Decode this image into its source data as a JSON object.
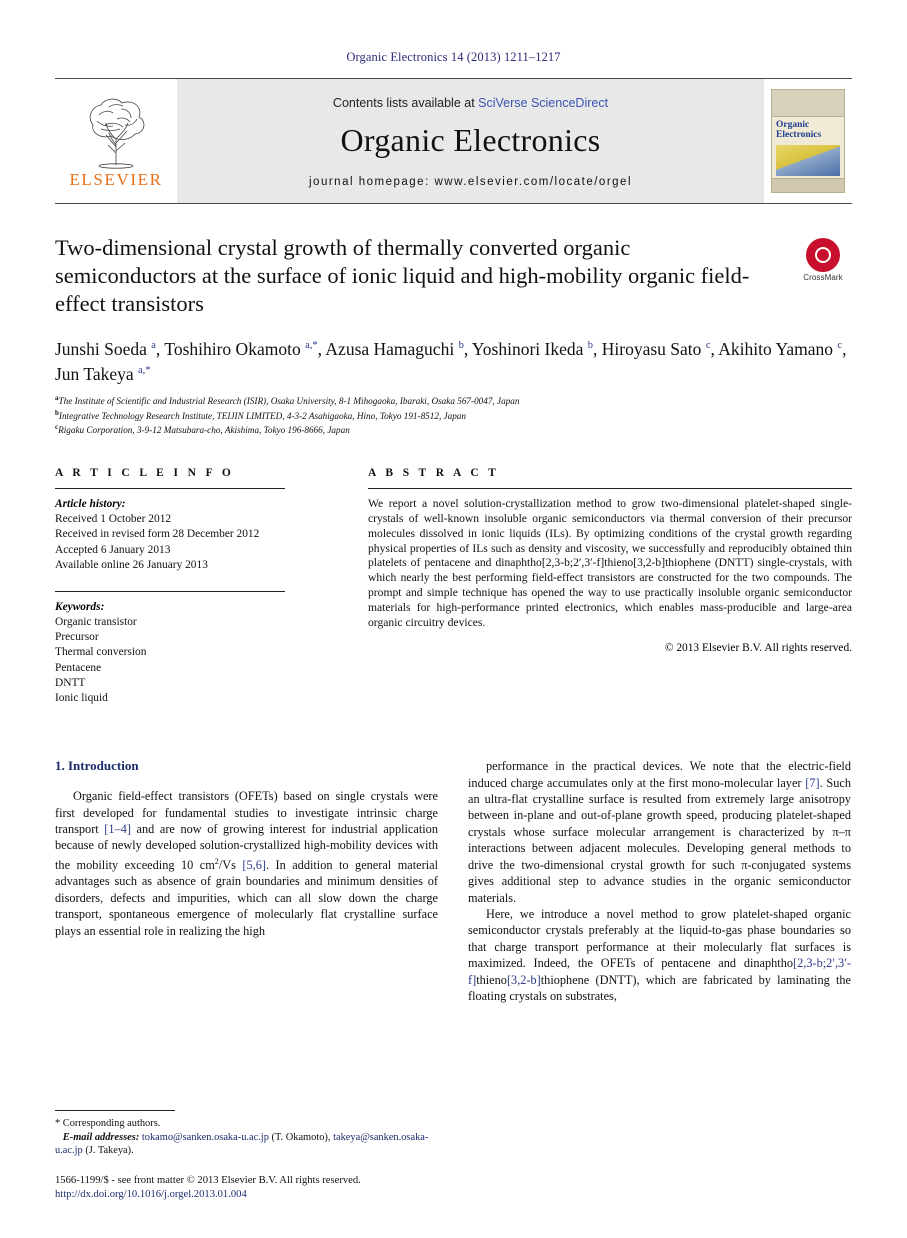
{
  "running_head": "Organic Electronics 14 (2013) 1211–1217",
  "banner": {
    "publisher_name": "ELSEVIER",
    "contents_prefix": "Contents lists available at ",
    "contents_link": "SciVerse ScienceDirect",
    "journal_name": "Organic Electronics",
    "homepage": "journal homepage: www.elsevier.com/locate/orgel",
    "cover_title_line1": "Organic",
    "cover_title_line2": "Electronics"
  },
  "article": {
    "title": "Two-dimensional crystal growth of thermally converted organic semiconductors at the surface of ionic liquid and high-mobility organic field-effect transistors",
    "crossmark_label": "CrossMark",
    "authors_html": "Junshi Soeda <sup>a</sup>, Toshihiro Okamoto <sup>a,</sup><sup>*</sup>, Azusa Hamaguchi <sup>b</sup>, Yoshinori Ikeda <sup>b</sup>, Hiroyasu Sato <sup>c</sup>, Akihito Yamano <sup>c</sup>, Jun Takeya <sup>a,</sup><sup>*</sup>",
    "affiliations": [
      "The Institute of Scientific and Industrial Research (ISIR), Osaka University, 8-1 Mihogaoka, Ibaraki, Osaka 567-0047, Japan",
      "Integrative Technology Research Institute, TEIJIN LIMITED, 4-3-2 Asahigaoka, Hino, Tokyo 191-8512, Japan",
      "Rigaku Corporation, 3-9-12 Matsubara-cho, Akishima, Tokyo 196-8666, Japan"
    ],
    "affiliation_marks": [
      "a",
      "b",
      "c"
    ]
  },
  "article_info": {
    "heading": "A R T I C L E    I N F O",
    "history_title": "Article history:",
    "history": [
      "Received 1 October 2012",
      "Received in revised form 28 December 2012",
      "Accepted 6 January 2013",
      "Available online 26 January 2013"
    ],
    "keywords_title": "Keywords:",
    "keywords": [
      "Organic transistor",
      "Precursor",
      "Thermal conversion",
      "Pentacene",
      "DNTT",
      "Ionic liquid"
    ]
  },
  "abstract": {
    "heading": "A B S T R A C T",
    "text": "We report a novel solution-crystallization method to grow two-dimensional platelet-shaped single-crystals of well-known insoluble organic semiconductors via thermal conversion of their precursor molecules dissolved in ionic liquids (ILs). By optimizing conditions of the crystal growth regarding physical properties of ILs such as density and viscosity, we successfully and reproducibly obtained thin platelets of pentacene and dinaphtho[2,3-b;2′,3′-f]thieno[3,2-b]thiophene (DNTT) single-crystals, with which nearly the best performing field-effect transistors are constructed for the two compounds. The prompt and simple technique has opened the way to use practically insoluble organic semiconductor materials for high-performance printed electronics, which enables mass-producible and large-area organic circuitry devices.",
    "copyright": "© 2013 Elsevier B.V. All rights reserved."
  },
  "body": {
    "section_heading": "1. Introduction",
    "left_paragraphs": [
      "Organic field-effect transistors (OFETs) based on single crystals were first developed for fundamental studies to investigate intrinsic charge transport [1–4] and are now of growing interest for industrial application because of newly developed solution-crystallized high-mobility devices with the mobility exceeding 10 cm2/Vs [5,6]. In addition to general material advantages such as absence of grain boundaries and minimum densities of disorders, defects and impurities, which can all slow down the charge transport, spontaneous emergence of molecularly flat crystalline surface plays an essential role in realizing the high"
    ],
    "right_paragraphs": [
      "performance in the practical devices. We note that the electric-field induced charge accumulates only at the first mono-molecular layer [7]. Such an ultra-flat crystalline surface is resulted from extremely large anisotropy between in-plane and out-of-plane growth speed, producing platelet-shaped crystals whose surface molecular arrangement is characterized by π–π interactions between adjacent molecules. Developing general methods to drive the two-dimensional crystal growth for such π-conjugated systems gives additional step to advance studies in the organic semiconductor materials.",
      "Here, we introduce a novel method to grow platelet-shaped organic semiconductor crystals preferably at the liquid-to-gas phase boundaries so that charge transport performance at their molecularly flat surfaces is maximized. Indeed, the OFETs of pentacene and dinaphtho[2,3-b;2′,3′-f]thieno[3,2-b]thiophene (DNTT), which are fabricated by laminating the floating crystals on substrates,"
    ]
  },
  "footnotes": {
    "corresponding": "* Corresponding authors.",
    "email_label": "E-mail addresses:",
    "email_text_1": "tokamo@sanken.osaka-u.ac.jp",
    "email_owner_1": "(T. Okamoto),",
    "email_text_2": "takeya@sanken.osaka-u.ac.jp",
    "email_owner_2": "(J. Takeya).",
    "front_matter": "1566-1199/$ - see front matter © 2013 Elsevier B.V. All rights reserved.",
    "doi": "http://dx.doi.org/10.1016/j.orgel.2013.01.004"
  },
  "colors": {
    "link_blue": "#2b3a8c",
    "heading_blue": "#1b2c6b",
    "elsevier_orange": "#e8701a",
    "crossmark_red": "#c8102e",
    "banner_grey": "#e8e8e8"
  }
}
